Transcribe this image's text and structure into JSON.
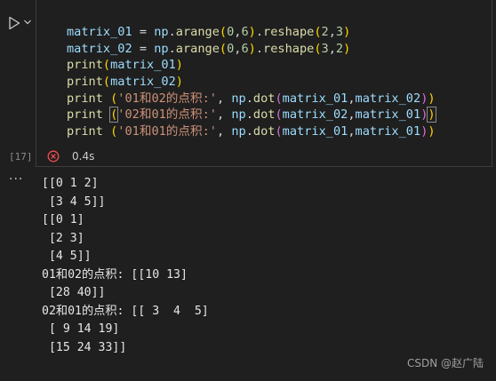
{
  "cell": {
    "execution_count": "[17]",
    "duration": "0.4s",
    "status": "error"
  },
  "code_lines": [
    [
      {
        "t": "matrix_01",
        "c": "var"
      },
      {
        "t": " = ",
        "c": "op"
      },
      {
        "t": "np",
        "c": "var"
      },
      {
        "t": ".",
        "c": "op"
      },
      {
        "t": "arange",
        "c": "fn"
      },
      {
        "t": "(",
        "c": "paren2"
      },
      {
        "t": "0",
        "c": "num"
      },
      {
        "t": ",",
        "c": "op"
      },
      {
        "t": "6",
        "c": "num"
      },
      {
        "t": ")",
        "c": "paren2"
      },
      {
        "t": ".",
        "c": "op"
      },
      {
        "t": "reshape",
        "c": "fn"
      },
      {
        "t": "(",
        "c": "paren2"
      },
      {
        "t": "2",
        "c": "num"
      },
      {
        "t": ",",
        "c": "op"
      },
      {
        "t": "3",
        "c": "num"
      },
      {
        "t": ")",
        "c": "paren2"
      }
    ],
    [
      {
        "t": "matrix_02",
        "c": "var"
      },
      {
        "t": " = ",
        "c": "op"
      },
      {
        "t": "np",
        "c": "var"
      },
      {
        "t": ".",
        "c": "op"
      },
      {
        "t": "arange",
        "c": "fn"
      },
      {
        "t": "(",
        "c": "paren2"
      },
      {
        "t": "0",
        "c": "num"
      },
      {
        "t": ",",
        "c": "op"
      },
      {
        "t": "6",
        "c": "num"
      },
      {
        "t": ")",
        "c": "paren2"
      },
      {
        "t": ".",
        "c": "op"
      },
      {
        "t": "reshape",
        "c": "fn"
      },
      {
        "t": "(",
        "c": "paren2"
      },
      {
        "t": "3",
        "c": "num"
      },
      {
        "t": ",",
        "c": "op"
      },
      {
        "t": "2",
        "c": "num"
      },
      {
        "t": ")",
        "c": "paren2"
      }
    ],
    [
      {
        "t": "print",
        "c": "fn"
      },
      {
        "t": "(",
        "c": "paren2"
      },
      {
        "t": "matrix_01",
        "c": "var"
      },
      {
        "t": ")",
        "c": "paren2"
      }
    ],
    [
      {
        "t": "print",
        "c": "fn"
      },
      {
        "t": "(",
        "c": "paren2"
      },
      {
        "t": "matrix_02",
        "c": "var"
      },
      {
        "t": ")",
        "c": "paren2"
      }
    ],
    [
      {
        "t": "print",
        "c": "fn"
      },
      {
        "t": " ",
        "c": "op"
      },
      {
        "t": "(",
        "c": "paren2"
      },
      {
        "t": "'01和02的点积:'",
        "c": "str"
      },
      {
        "t": ", ",
        "c": "op"
      },
      {
        "t": "np",
        "c": "var"
      },
      {
        "t": ".",
        "c": "op"
      },
      {
        "t": "dot",
        "c": "fn"
      },
      {
        "t": "(",
        "c": "paren"
      },
      {
        "t": "matrix_01",
        "c": "var"
      },
      {
        "t": ",",
        "c": "op"
      },
      {
        "t": "matrix_02",
        "c": "var"
      },
      {
        "t": ")",
        "c": "paren"
      },
      {
        "t": ")",
        "c": "paren2"
      }
    ],
    [
      {
        "t": "print",
        "c": "fn"
      },
      {
        "t": " ",
        "c": "op"
      },
      {
        "t": "(",
        "c": "paren2 bracket-box"
      },
      {
        "t": "'02和01的点积:'",
        "c": "str"
      },
      {
        "t": ", ",
        "c": "op"
      },
      {
        "t": "np",
        "c": "var"
      },
      {
        "t": ".",
        "c": "op"
      },
      {
        "t": "dot",
        "c": "fn"
      },
      {
        "t": "(",
        "c": "paren"
      },
      {
        "t": "matrix_02",
        "c": "var"
      },
      {
        "t": ",",
        "c": "op"
      },
      {
        "t": "matrix_01",
        "c": "var"
      },
      {
        "t": ")",
        "c": "paren"
      },
      {
        "t": ")",
        "c": "paren2 bracket-box"
      }
    ],
    [
      {
        "t": "print",
        "c": "fn"
      },
      {
        "t": " ",
        "c": "op"
      },
      {
        "t": "(",
        "c": "paren2"
      },
      {
        "t": "'01和01的点积:'",
        "c": "str"
      },
      {
        "t": ", ",
        "c": "op"
      },
      {
        "t": "np",
        "c": "var"
      },
      {
        "t": ".",
        "c": "op"
      },
      {
        "t": "dot",
        "c": "fn"
      },
      {
        "t": "(",
        "c": "paren"
      },
      {
        "t": "matrix_01",
        "c": "var"
      },
      {
        "t": ",",
        "c": "op"
      },
      {
        "t": "matrix_01",
        "c": "var"
      },
      {
        "t": ")",
        "c": "paren"
      },
      {
        "t": ")",
        "c": "paren2"
      }
    ]
  ],
  "output_lines": [
    "[[0 1 2]",
    " [3 4 5]]",
    "[[0 1]",
    " [2 3]",
    " [4 5]]",
    "01和02的点积: [[10 13]",
    " [28 40]]",
    "02和01的点积: [[ 3  4  5]",
    " [ 9 14 19]",
    " [15 24 33]]"
  ],
  "watermark": "CSDN @赵广陆",
  "icons": {
    "run": "run-cell-icon",
    "chevron": "chevron-down-icon",
    "error": "error-circle-icon",
    "more": "more-actions-icon"
  },
  "colors": {
    "background": "#1f1f1f",
    "error": "#f14c4c",
    "keyword_fn": "#dcdcaa",
    "variable": "#9cdcfe",
    "string": "#ce9178",
    "number": "#b5cea8"
  }
}
